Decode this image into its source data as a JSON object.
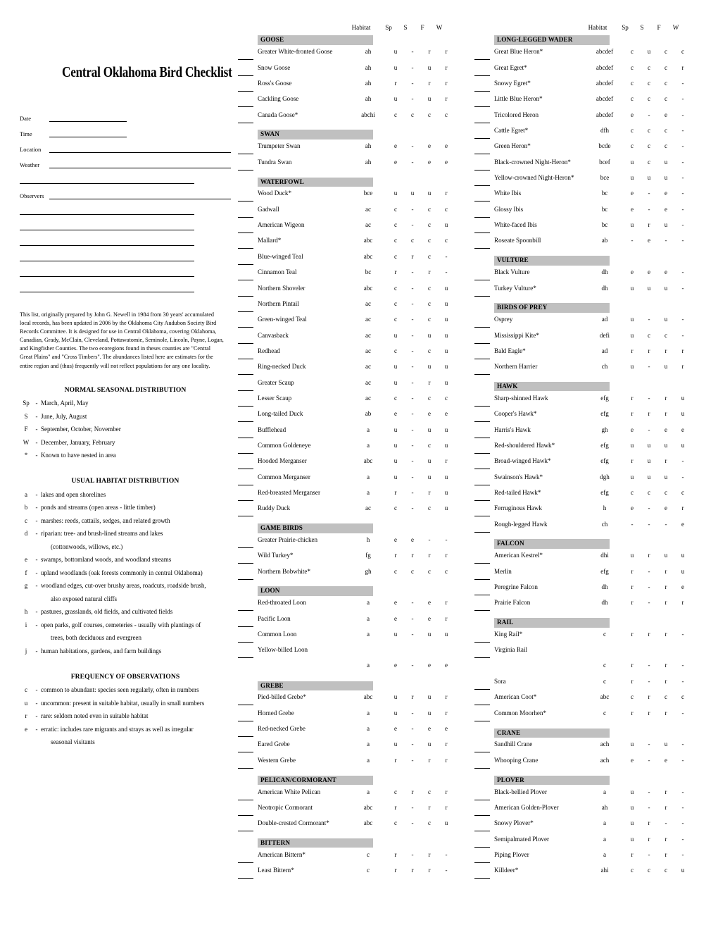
{
  "title": "Central Oklahoma Bird Checklist",
  "form": {
    "date_label": "Date",
    "time_label": "Time",
    "location_label": "Location",
    "weather_label": "Weather",
    "observers_label": "Observers"
  },
  "intro": "This list, originally prepared by John G. Newell in 1984 from 30 years' accumulated local records, has been updated in 2006 by the Oklahoma City Audubon Society Bird Records Committee.  It is designed for use in Central Oklahoma, covering Oklahoma, Canadian, Grady, McClain, Cleveland, Pottawatomie, Seminole, Lincoln, Payne, Logan, and Kingfisher Counties. The two ecoregions found in theses counties are \"Central Great Plains\" and \"Cross Timbers\". The abundances listed here are estimates for the entire region and (thus) frequently will not reflect populations for any one locality.",
  "seasonal": {
    "heading": "NORMAL SEASONAL DISTRIBUTION",
    "items": [
      {
        "key": "Sp",
        "dash": "-",
        "text": "March, April, May"
      },
      {
        "key": "S",
        "dash": "-",
        "text": "June, July, August"
      },
      {
        "key": "F",
        "dash": "-",
        "text": "September, October, November"
      },
      {
        "key": "W",
        "dash": "-",
        "text": "December, January, February"
      },
      {
        "key": "*",
        "dash": "-",
        "text": "Known to have nested in area"
      }
    ]
  },
  "habitat": {
    "heading": "USUAL HABITAT DISTRIBUTION",
    "items": [
      {
        "key": "a",
        "dash": "-",
        "text": "lakes and open shorelines"
      },
      {
        "key": "b",
        "dash": "-",
        "text": "ponds and streams (open areas - little timber)"
      },
      {
        "key": "c",
        "dash": "-",
        "text": "marshes: reeds, cattails, sedges, and related growth"
      },
      {
        "key": "d",
        "dash": "-",
        "text": "riparian: tree- and brush-lined streams and lakes"
      },
      {
        "key": "",
        "dash": "",
        "text": "(cottonwoods, willows, etc.)"
      },
      {
        "key": "e",
        "dash": "-",
        "text": "swamps, bottomland woods, and woodland streams"
      },
      {
        "key": "f",
        "dash": "-",
        "text": "upland woodlands (oak forests commonly in central Oklahoma)"
      },
      {
        "key": "g",
        "dash": "-",
        "text": "woodland edges, cut-over brushy areas, roadcuts, roadside brush,"
      },
      {
        "key": "",
        "dash": "",
        "text": "also exposed natural cliffs"
      },
      {
        "key": "h",
        "dash": "-",
        "text": "pastures, grasslands, old fields, and cultivated fields"
      },
      {
        "key": "i",
        "dash": "-",
        "text": "open parks, golf courses, cemeteries - usually with plantings of"
      },
      {
        "key": "",
        "dash": "",
        "text": "trees, both deciduous and evergreen"
      },
      {
        "key": "j",
        "dash": "-",
        "text": "human habitations, gardens, and farm buildings"
      }
    ]
  },
  "frequency": {
    "heading": "FREQUENCY OF OBSERVATIONS",
    "items": [
      {
        "key": "c",
        "dash": "-",
        "text": "common to abundant: species seen regularly, often in numbers"
      },
      {
        "key": "u",
        "dash": "-",
        "text": "uncommon: present in suitable habitat, usually in small numbers"
      },
      {
        "key": "r",
        "dash": "-",
        "text": "rare: seldom noted even in suitable habitat"
      },
      {
        "key": "e",
        "dash": "-",
        "text": "erratic: includes rare migrants and strays as well as irregular"
      },
      {
        "key": "",
        "dash": "",
        "text": "seasonal visitants"
      }
    ]
  },
  "column_headers": {
    "habitat": "Habitat",
    "sp": "Sp",
    "s": "S",
    "f": "F",
    "w": "W"
  },
  "middle_column": [
    {
      "type": "group",
      "label": "GOOSE"
    },
    {
      "type": "species",
      "name": "Greater White-fronted Goose",
      "habitat": "ah",
      "sp": "u",
      "s": "-",
      "f": "r",
      "w": "r"
    },
    {
      "type": "species",
      "name": "Snow Goose",
      "habitat": "ah",
      "sp": "u",
      "s": "-",
      "f": "u",
      "w": "r"
    },
    {
      "type": "species",
      "name": "Ross's Goose",
      "habitat": "ah",
      "sp": "r",
      "s": "-",
      "f": "r",
      "w": "r"
    },
    {
      "type": "species",
      "name": "Cackling Goose",
      "habitat": "ah",
      "sp": "u",
      "s": "-",
      "f": "u",
      "w": "r"
    },
    {
      "type": "species",
      "name": "Canada Goose*",
      "habitat": "abchi",
      "sp": "c",
      "s": "c",
      "f": "c",
      "w": "c"
    },
    {
      "type": "group",
      "label": "SWAN"
    },
    {
      "type": "species",
      "name": "Trumpeter Swan",
      "habitat": "ah",
      "sp": "e",
      "s": "-",
      "f": "e",
      "w": "e"
    },
    {
      "type": "species",
      "name": "Tundra Swan",
      "habitat": "ah",
      "sp": "e",
      "s": "-",
      "f": "e",
      "w": "e"
    },
    {
      "type": "group",
      "label": "WATERFOWL"
    },
    {
      "type": "species",
      "name": "Wood Duck*",
      "habitat": "bce",
      "sp": "u",
      "s": "u",
      "f": "u",
      "w": "r"
    },
    {
      "type": "species",
      "name": "Gadwall",
      "habitat": "ac",
      "sp": "c",
      "s": "-",
      "f": "c",
      "w": "c"
    },
    {
      "type": "species",
      "name": "American Wigeon",
      "habitat": "ac",
      "sp": "c",
      "s": "-",
      "f": "c",
      "w": "u"
    },
    {
      "type": "species",
      "name": "Mallard*",
      "habitat": "abc",
      "sp": "c",
      "s": "c",
      "f": "c",
      "w": "c"
    },
    {
      "type": "species",
      "name": "Blue-winged Teal",
      "habitat": "abc",
      "sp": "c",
      "s": "r",
      "f": "c",
      "w": "-"
    },
    {
      "type": "species",
      "name": "Cinnamon Teal",
      "habitat": "bc",
      "sp": "r",
      "s": "-",
      "f": "r",
      "w": "-"
    },
    {
      "type": "species",
      "name": "Northern Shoveler",
      "habitat": "abc",
      "sp": "c",
      "s": "-",
      "f": "c",
      "w": "u"
    },
    {
      "type": "species",
      "name": "Northern Pintail",
      "habitat": "ac",
      "sp": "c",
      "s": "-",
      "f": "c",
      "w": "u"
    },
    {
      "type": "species",
      "name": "Green-winged Teal",
      "habitat": "ac",
      "sp": "c",
      "s": "-",
      "f": "c",
      "w": "u"
    },
    {
      "type": "species",
      "name": "Canvasback",
      "habitat": "ac",
      "sp": "u",
      "s": "-",
      "f": "u",
      "w": "u"
    },
    {
      "type": "species",
      "name": "Redhead",
      "habitat": "ac",
      "sp": "c",
      "s": "-",
      "f": "c",
      "w": "u"
    },
    {
      "type": "species",
      "name": "Ring-necked Duck",
      "habitat": "ac",
      "sp": "u",
      "s": "-",
      "f": "u",
      "w": "u"
    },
    {
      "type": "species",
      "name": "Greater Scaup",
      "habitat": "ac",
      "sp": "u",
      "s": "-",
      "f": "r",
      "w": "u"
    },
    {
      "type": "species",
      "name": "Lesser Scaup",
      "habitat": "ac",
      "sp": "c",
      "s": "-",
      "f": "c",
      "w": "c"
    },
    {
      "type": "species",
      "name": "Long-tailed Duck",
      "habitat": "ab",
      "sp": "e",
      "s": "-",
      "f": "e",
      "w": "e"
    },
    {
      "type": "species",
      "name": "Bufflehead",
      "habitat": "a",
      "sp": "u",
      "s": "-",
      "f": "u",
      "w": "u"
    },
    {
      "type": "species",
      "name": "Common Goldeneye",
      "habitat": "a",
      "sp": "u",
      "s": "-",
      "f": "c",
      "w": "u"
    },
    {
      "type": "species",
      "name": "Hooded Merganser",
      "habitat": "abc",
      "sp": "u",
      "s": "-",
      "f": "u",
      "w": "r"
    },
    {
      "type": "species",
      "name": "Common Merganser",
      "habitat": "a",
      "sp": "u",
      "s": "-",
      "f": "u",
      "w": "u"
    },
    {
      "type": "species",
      "name": "Red-breasted Merganser",
      "habitat": "a",
      "sp": "r",
      "s": "-",
      "f": "r",
      "w": "u"
    },
    {
      "type": "species",
      "name": "Ruddy Duck",
      "habitat": "ac",
      "sp": "c",
      "s": "-",
      "f": "c",
      "w": "u"
    },
    {
      "type": "group",
      "label": "GAME BIRDS"
    },
    {
      "type": "species",
      "name": "Greater Prairie-chicken",
      "habitat": "h",
      "sp": "e",
      "s": "e",
      "f": "-",
      "w": "-"
    },
    {
      "type": "species",
      "name": "Wild Turkey*",
      "habitat": "fg",
      "sp": "r",
      "s": "r",
      "f": "r",
      "w": "r"
    },
    {
      "type": "species",
      "name": "Northern Bobwhite*",
      "habitat": "gh",
      "sp": "c",
      "s": "c",
      "f": "c",
      "w": "c"
    },
    {
      "type": "group",
      "label": "LOON"
    },
    {
      "type": "species",
      "name": "Red-throated Loon",
      "habitat": "a",
      "sp": "e",
      "s": "-",
      "f": "e",
      "w": "r"
    },
    {
      "type": "species",
      "name": "Pacific Loon",
      "habitat": "a",
      "sp": "e",
      "s": "-",
      "f": "e",
      "w": "r"
    },
    {
      "type": "species",
      "name": "Common Loon",
      "habitat": "a",
      "sp": "u",
      "s": "-",
      "f": "u",
      "w": "u"
    },
    {
      "type": "species",
      "name": "Yellow-billed Loon",
      "habitat": "a",
      "sp": "e",
      "s": "-",
      "f": "e",
      "w": "e",
      "wrapped": true
    },
    {
      "type": "group",
      "label": "GREBE"
    },
    {
      "type": "species",
      "name": "Pied-billed Grebe*",
      "habitat": "abc",
      "sp": "u",
      "s": "r",
      "f": "u",
      "w": "r"
    },
    {
      "type": "species",
      "name": "Horned Grebe",
      "habitat": "a",
      "sp": "u",
      "s": "-",
      "f": "u",
      "w": "r"
    },
    {
      "type": "species",
      "name": "Red-necked Grebe",
      "habitat": "a",
      "sp": "e",
      "s": "-",
      "f": "e",
      "w": "e"
    },
    {
      "type": "species",
      "name": "Eared Grebe",
      "habitat": "a",
      "sp": "u",
      "s": "-",
      "f": "u",
      "w": "r"
    },
    {
      "type": "species",
      "name": "Western Grebe",
      "habitat": "a",
      "sp": "r",
      "s": "-",
      "f": "r",
      "w": "r"
    },
    {
      "type": "group",
      "label": "PELICAN/CORMORANT"
    },
    {
      "type": "species",
      "name": "American White Pelican",
      "habitat": "a",
      "sp": "c",
      "s": "r",
      "f": "c",
      "w": "r"
    },
    {
      "type": "species",
      "name": "Neotropic Cormorant",
      "habitat": "abc",
      "sp": "r",
      "s": "-",
      "f": "r",
      "w": "r"
    },
    {
      "type": "species",
      "name": "Double-crested Cormorant*",
      "habitat": "abc",
      "sp": "c",
      "s": "-",
      "f": "c",
      "w": "u"
    },
    {
      "type": "group",
      "label": "BITTERN"
    },
    {
      "type": "species",
      "name": "American Bittern*",
      "habitat": "c",
      "sp": "r",
      "s": "-",
      "f": "r",
      "w": "-"
    },
    {
      "type": "species",
      "name": "Least Bittern*",
      "habitat": "c",
      "sp": "r",
      "s": "r",
      "f": "r",
      "w": "-"
    }
  ],
  "right_column": [
    {
      "type": "group",
      "label": "LONG-LEGGED WADER"
    },
    {
      "type": "species",
      "name": "Great Blue Heron*",
      "habitat": "abcdef",
      "sp": "c",
      "s": "u",
      "f": "c",
      "w": "c"
    },
    {
      "type": "species",
      "name": "Great Egret*",
      "habitat": "abcdef",
      "sp": "c",
      "s": "c",
      "f": "c",
      "w": "r"
    },
    {
      "type": "species",
      "name": "Snowy Egret*",
      "habitat": "abcdef",
      "sp": "c",
      "s": "c",
      "f": "c",
      "w": "-"
    },
    {
      "type": "species",
      "name": "Little Blue Heron*",
      "habitat": "abcdef",
      "sp": "c",
      "s": "c",
      "f": "c",
      "w": "-"
    },
    {
      "type": "species",
      "name": "Tricolored Heron",
      "habitat": "abcdef",
      "sp": "e",
      "s": "-",
      "f": "e",
      "w": "-"
    },
    {
      "type": "species",
      "name": "Cattle Egret*",
      "habitat": "dfh",
      "sp": "c",
      "s": "c",
      "f": "c",
      "w": "-"
    },
    {
      "type": "species",
      "name": "Green Heron*",
      "habitat": "bcde",
      "sp": "c",
      "s": "c",
      "f": "c",
      "w": "-"
    },
    {
      "type": "species",
      "name": "Black-crowned Night-Heron*",
      "habitat": "bcef",
      "sp": "u",
      "s": "c",
      "f": "u",
      "w": "-"
    },
    {
      "type": "species",
      "name": "Yellow-crowned Night-Heron*",
      "habitat": "bce",
      "sp": "u",
      "s": "u",
      "f": "u",
      "w": "-"
    },
    {
      "type": "species",
      "name": "White Ibis",
      "habitat": "bc",
      "sp": "e",
      "s": "-",
      "f": "e",
      "w": "-"
    },
    {
      "type": "species",
      "name": "Glossy Ibis",
      "habitat": "bc",
      "sp": "e",
      "s": "-",
      "f": "e",
      "w": "-"
    },
    {
      "type": "species",
      "name": "White-faced Ibis",
      "habitat": "bc",
      "sp": "u",
      "s": "r",
      "f": "u",
      "w": "-"
    },
    {
      "type": "species",
      "name": "Roseate Spoonbill",
      "habitat": "ab",
      "sp": "-",
      "s": "e",
      "f": "-",
      "w": "-"
    },
    {
      "type": "group",
      "label": "VULTURE"
    },
    {
      "type": "species",
      "name": "Black Vulture",
      "habitat": "dh",
      "sp": "e",
      "s": "e",
      "f": "e",
      "w": "-"
    },
    {
      "type": "species",
      "name": "Turkey Vulture*",
      "habitat": "dh",
      "sp": "u",
      "s": "u",
      "f": "u",
      "w": "-"
    },
    {
      "type": "group",
      "label": "BIRDS OF PREY"
    },
    {
      "type": "species",
      "name": "Osprey",
      "habitat": "ad",
      "sp": "u",
      "s": "-",
      "f": "u",
      "w": "-"
    },
    {
      "type": "species",
      "name": "Mississippi Kite*",
      "habitat": "defi",
      "sp": "u",
      "s": "c",
      "f": "c",
      "w": "-"
    },
    {
      "type": "species",
      "name": "Bald Eagle*",
      "habitat": "ad",
      "sp": "r",
      "s": "r",
      "f": "r",
      "w": "r"
    },
    {
      "type": "species",
      "name": "Northern Harrier",
      "habitat": "ch",
      "sp": "u",
      "s": "-",
      "f": "u",
      "w": "r"
    },
    {
      "type": "group",
      "label": "HAWK"
    },
    {
      "type": "species",
      "name": "Sharp-shinned Hawk",
      "habitat": "efg",
      "sp": "r",
      "s": "-",
      "f": "r",
      "w": "u"
    },
    {
      "type": "species",
      "name": "Cooper's Hawk*",
      "habitat": "efg",
      "sp": "r",
      "s": "r",
      "f": "r",
      "w": "u"
    },
    {
      "type": "species",
      "name": "Harris's Hawk",
      "habitat": "gh",
      "sp": "e",
      "s": "-",
      "f": "e",
      "w": "e"
    },
    {
      "type": "species",
      "name": "Red-shouldered Hawk*",
      "habitat": "efg",
      "sp": "u",
      "s": "u",
      "f": "u",
      "w": "u"
    },
    {
      "type": "species",
      "name": "Broad-winged Hawk*",
      "habitat": "efg",
      "sp": "r",
      "s": "u",
      "f": "r",
      "w": "-"
    },
    {
      "type": "species",
      "name": "Swainson's Hawk*",
      "habitat": "dgh",
      "sp": "u",
      "s": "u",
      "f": "u",
      "w": "-"
    },
    {
      "type": "species",
      "name": "Red-tailed Hawk*",
      "habitat": "efg",
      "sp": "c",
      "s": "c",
      "f": "c",
      "w": "c"
    },
    {
      "type": "species",
      "name": "Ferruginous Hawk",
      "habitat": "h",
      "sp": "e",
      "s": "-",
      "f": "e",
      "w": "r"
    },
    {
      "type": "species",
      "name": "Rough-legged Hawk",
      "habitat": "ch",
      "sp": "-",
      "s": "-",
      "f": "-",
      "w": "e"
    },
    {
      "type": "group",
      "label": "FALCON"
    },
    {
      "type": "species",
      "name": "American Kestrel*",
      "habitat": "dhi",
      "sp": "u",
      "s": "r",
      "f": "u",
      "w": "u"
    },
    {
      "type": "species",
      "name": "Merlin",
      "habitat": "efg",
      "sp": "r",
      "s": "-",
      "f": "r",
      "w": "u"
    },
    {
      "type": "species",
      "name": "Peregrine Falcon",
      "habitat": "dh",
      "sp": "r",
      "s": "-",
      "f": "r",
      "w": "e"
    },
    {
      "type": "species",
      "name": "Prairie Falcon",
      "habitat": "dh",
      "sp": "r",
      "s": "-",
      "f": "r",
      "w": "r"
    },
    {
      "type": "group",
      "label": "RAIL"
    },
    {
      "type": "species",
      "name": "King Rail*",
      "habitat": "c",
      "sp": "r",
      "s": "r",
      "f": "r",
      "w": "-"
    },
    {
      "type": "species",
      "name": "Virginia Rail",
      "habitat": "c",
      "sp": "r",
      "s": "-",
      "f": "r",
      "w": "-",
      "wrapped": true
    },
    {
      "type": "species",
      "name": "Sora",
      "habitat": "c",
      "sp": "r",
      "s": "-",
      "f": "r",
      "w": "-"
    },
    {
      "type": "species",
      "name": "American Coot*",
      "habitat": "abc",
      "sp": "c",
      "s": "r",
      "f": "c",
      "w": "c"
    },
    {
      "type": "species",
      "name": "Common Moorhen*",
      "habitat": "c",
      "sp": "r",
      "s": "r",
      "f": "r",
      "w": "-"
    },
    {
      "type": "group",
      "label": "CRANE"
    },
    {
      "type": "species",
      "name": "Sandhill Crane",
      "habitat": "ach",
      "sp": "u",
      "s": "-",
      "f": "u",
      "w": "-"
    },
    {
      "type": "species",
      "name": "Whooping Crane",
      "habitat": "ach",
      "sp": "e",
      "s": "-",
      "f": "e",
      "w": "-"
    },
    {
      "type": "group",
      "label": "PLOVER"
    },
    {
      "type": "species",
      "name": "Black-bellied Plover",
      "habitat": "a",
      "sp": "u",
      "s": "-",
      "f": "r",
      "w": "-"
    },
    {
      "type": "species",
      "name": "American Golden-Plover",
      "habitat": "ah",
      "sp": "u",
      "s": "-",
      "f": "r",
      "w": "-"
    },
    {
      "type": "species",
      "name": "Snowy Plover*",
      "habitat": "a",
      "sp": "u",
      "s": "r",
      "f": "-",
      "w": "-"
    },
    {
      "type": "species",
      "name": "Semipalmated Plover",
      "habitat": "a",
      "sp": "u",
      "s": "r",
      "f": "r",
      "w": "-"
    },
    {
      "type": "species",
      "name": "Piping Plover",
      "habitat": "a",
      "sp": "r",
      "s": "-",
      "f": "r",
      "w": "-"
    },
    {
      "type": "species",
      "name": "Killdeer*",
      "habitat": "ahi",
      "sp": "c",
      "s": "c",
      "f": "c",
      "w": "u"
    }
  ]
}
